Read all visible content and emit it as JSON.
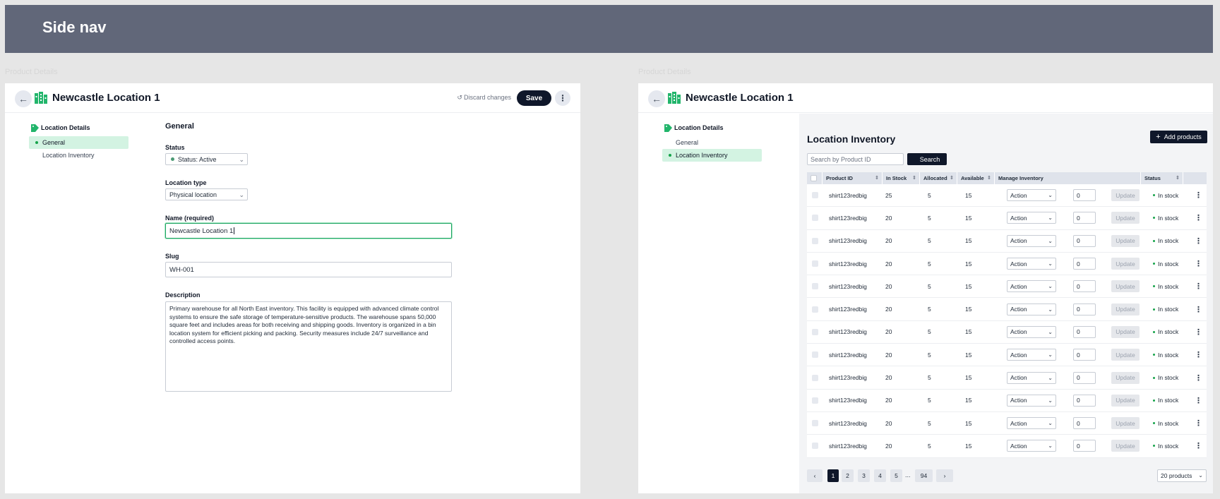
{
  "banner": {
    "title": "Side nav"
  },
  "frame_labels": [
    "Product Details",
    "Product Details"
  ],
  "header": {
    "title": "Newcastle Location 1",
    "discard_label": "Discard changes",
    "save_label": "Save"
  },
  "sidebar": {
    "heading": "Location Details",
    "items": [
      "General",
      "Location Inventory"
    ]
  },
  "form": {
    "section_title": "General",
    "status": {
      "label": "Status",
      "value": "Status: Active"
    },
    "location_type": {
      "label": "Location type",
      "value": "Physical location"
    },
    "name": {
      "label": "Name (required)",
      "value": "Newcastle Location 1"
    },
    "slug": {
      "label": "Slug",
      "value": "WH-001"
    },
    "description": {
      "label": "Description",
      "value": "Primary warehouse for all North East inventory. This facility is equipped with advanced climate control systems to ensure the safe storage of temperature-sensitive products. The warehouse spans 50,000 square feet and includes areas for both receiving and shipping goods. Inventory is organized in a bin location system for efficient picking and packing. Security measures include 24/7 surveillance and controlled access points."
    }
  },
  "inventory": {
    "title": "Location Inventory",
    "add_label": "Add products",
    "search_placeholder": "Search by Product ID",
    "search_button": "Search",
    "columns": [
      "Product ID",
      "In Stock",
      "Allocated",
      "Available",
      "Manage Inventory",
      "Status"
    ],
    "rows": [
      {
        "product_id": "shirt123redbig",
        "in_stock": "25",
        "allocated": "5",
        "available": "15",
        "action": "Action",
        "qty": "0",
        "update": "Update",
        "status": "In stock"
      },
      {
        "product_id": "shirt123redbig",
        "in_stock": "20",
        "allocated": "5",
        "available": "15",
        "action": "Action",
        "qty": "0",
        "update": "Update",
        "status": "In stock"
      },
      {
        "product_id": "shirt123redbig",
        "in_stock": "20",
        "allocated": "5",
        "available": "15",
        "action": "Action",
        "qty": "0",
        "update": "Update",
        "status": "In stock"
      },
      {
        "product_id": "shirt123redbig",
        "in_stock": "20",
        "allocated": "5",
        "available": "15",
        "action": "Action",
        "qty": "0",
        "update": "Update",
        "status": "In stock"
      },
      {
        "product_id": "shirt123redbig",
        "in_stock": "20",
        "allocated": "5",
        "available": "15",
        "action": "Action",
        "qty": "0",
        "update": "Update",
        "status": "In stock"
      },
      {
        "product_id": "shirt123redbig",
        "in_stock": "20",
        "allocated": "5",
        "available": "15",
        "action": "Action",
        "qty": "0",
        "update": "Update",
        "status": "In stock"
      },
      {
        "product_id": "shirt123redbig",
        "in_stock": "20",
        "allocated": "5",
        "available": "15",
        "action": "Action",
        "qty": "0",
        "update": "Update",
        "status": "In stock"
      },
      {
        "product_id": "shirt123redbig",
        "in_stock": "20",
        "allocated": "5",
        "available": "15",
        "action": "Action",
        "qty": "0",
        "update": "Update",
        "status": "In stock"
      },
      {
        "product_id": "shirt123redbig",
        "in_stock": "20",
        "allocated": "5",
        "available": "15",
        "action": "Action",
        "qty": "0",
        "update": "Update",
        "status": "In stock"
      },
      {
        "product_id": "shirt123redbig",
        "in_stock": "20",
        "allocated": "5",
        "available": "15",
        "action": "Action",
        "qty": "0",
        "update": "Update",
        "status": "In stock"
      },
      {
        "product_id": "shirt123redbig",
        "in_stock": "20",
        "allocated": "5",
        "available": "15",
        "action": "Action",
        "qty": "0",
        "update": "Update",
        "status": "In stock"
      },
      {
        "product_id": "shirt123redbig",
        "in_stock": "20",
        "allocated": "5",
        "available": "15",
        "action": "Action",
        "qty": "0",
        "update": "Update",
        "status": "In stock"
      }
    ],
    "pagination": {
      "pages": [
        "1",
        "2",
        "3",
        "4",
        "5"
      ],
      "ellipsis": "...",
      "last": "94",
      "current": "1",
      "per_page": "20 products"
    }
  },
  "colors": {
    "banner": "#616779",
    "accent_green": "#1ea463",
    "active_nav": "#d3f3e2",
    "primary_dark": "#0f172a"
  }
}
